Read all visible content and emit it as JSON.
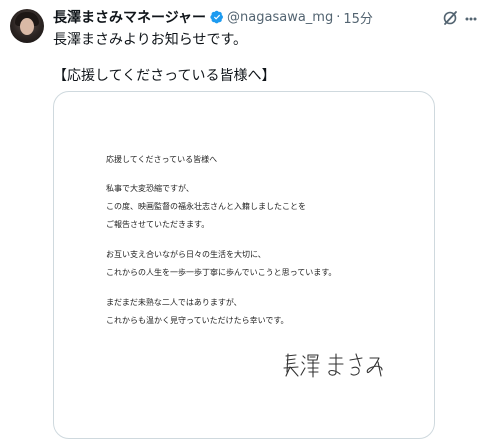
{
  "tweet": {
    "author_name": "長澤まさみマネージャー",
    "handle": "@nagasawa_mg",
    "separator": "·",
    "time": "15分",
    "text_line1": "長澤まさみよりお知らせです。",
    "text_line2": "【応援してくださっている皆様へ】"
  },
  "letter": {
    "greeting": "応援してくださっている皆様へ",
    "lines": [
      "私事で大変恐縮ですが、",
      "この度、映画監督の福永壮志さんと入籍しましたことを",
      "ご報告させていただきます。",
      "お互い支え合いながら日々の生活を大切に、",
      "これからの人生を一歩一歩丁寧に歩んでいこうと思っています。",
      "まだまだ未熟な二人ではありますが、",
      "これからも温かく見守っていただけたら幸いです。"
    ],
    "signature": "長澤まさみ"
  },
  "icons": {
    "verified": "verified-badge-icon",
    "grok": "grok-icon",
    "more": "more-icon"
  },
  "colors": {
    "verified": "#1d9bf0",
    "secondary_text": "#536471",
    "border": "#cfd9de"
  }
}
